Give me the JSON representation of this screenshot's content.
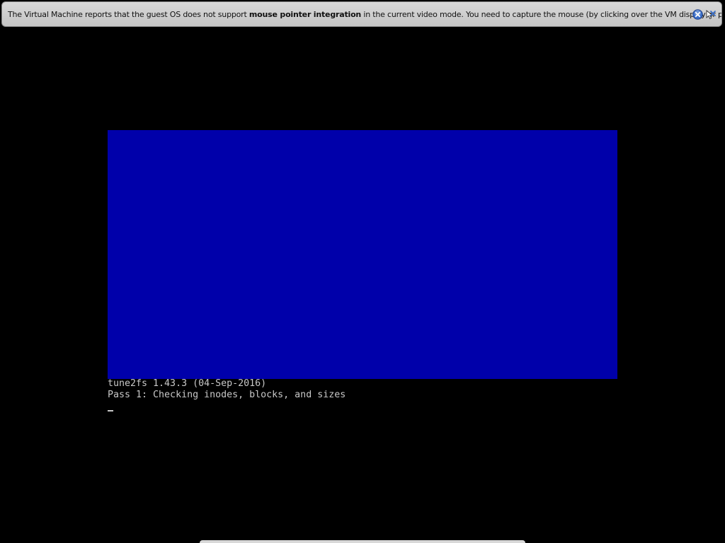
{
  "banner": {
    "text_before": "The Virtual Machine reports that the guest OS does not support ",
    "text_bold": "mouse pointer integration",
    "text_after": " in the current video mode. You need to capture the mouse (by clicking over the VM display or pressing",
    "close_icon": "close-icon",
    "mute_icon": "do-not-show-again-icon",
    "accent_color": "#3a6fc9"
  },
  "console": {
    "background": "#000000",
    "blue_area_color": "#0000aa",
    "lines": [
      "tune2fs 1.43.3 (04-Sep-2016)",
      "Pass 1: Checking inodes, blocks, and sizes"
    ],
    "cursor": "_"
  }
}
